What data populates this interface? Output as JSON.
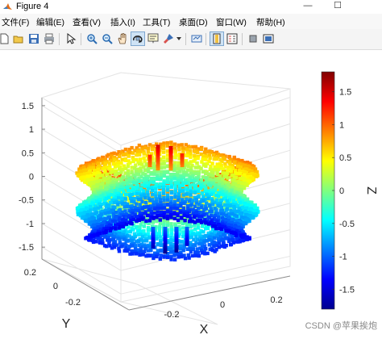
{
  "window": {
    "title": "Figure 4"
  },
  "window_controls": {
    "minimize": "—",
    "maximize": "☐"
  },
  "menu": [
    {
      "label": "文件(F)"
    },
    {
      "label": "编辑(E)"
    },
    {
      "label": "查看(V)"
    },
    {
      "label": "插入(I)"
    },
    {
      "label": "工具(T)"
    },
    {
      "label": "桌面(D)"
    },
    {
      "label": "窗口(W)"
    },
    {
      "label": "帮助(H)"
    }
  ],
  "toolbar": [
    {
      "icon": "new-figure-icon"
    },
    {
      "icon": "open-icon"
    },
    {
      "icon": "save-icon"
    },
    {
      "icon": "print-icon"
    },
    {
      "icon": "edit-plot-icon"
    },
    {
      "icon": "zoom-in-icon"
    },
    {
      "icon": "zoom-out-icon"
    },
    {
      "icon": "pan-icon"
    },
    {
      "icon": "rotate-3d-icon",
      "pressed": true
    },
    {
      "icon": "data-cursor-icon"
    },
    {
      "icon": "brush-icon"
    },
    {
      "icon": "link-plot-icon"
    },
    {
      "icon": "insert-colorbar-icon",
      "pressed": true
    },
    {
      "icon": "insert-legend-icon"
    },
    {
      "icon": "hide-plot-tools-icon"
    },
    {
      "icon": "show-plot-tools-icon"
    }
  ],
  "chart_data": {
    "type": "scatter",
    "title": "",
    "xlabel": "X",
    "ylabel": "Y",
    "zlabel": "Z",
    "z_ticks": [
      "1.5",
      "1",
      "0.5",
      "0",
      "-0.5",
      "-1",
      "-1.5"
    ],
    "y_ticks": [
      "0.2",
      "0",
      "-0.2"
    ],
    "x_ticks": [
      "-0.2",
      "0",
      "0.2"
    ],
    "zlim": [
      -1.6,
      1.6
    ],
    "grid": true,
    "colormap": "jet",
    "colorbar": {
      "label": "Z",
      "ticks": [
        "1.5",
        "1",
        "0.5",
        "0",
        "-0.5",
        "-1",
        "-1.5"
      ],
      "range": [
        -1.8,
        1.8
      ],
      "position": "right"
    }
  },
  "watermark": "CSDN @苹果挨炮"
}
